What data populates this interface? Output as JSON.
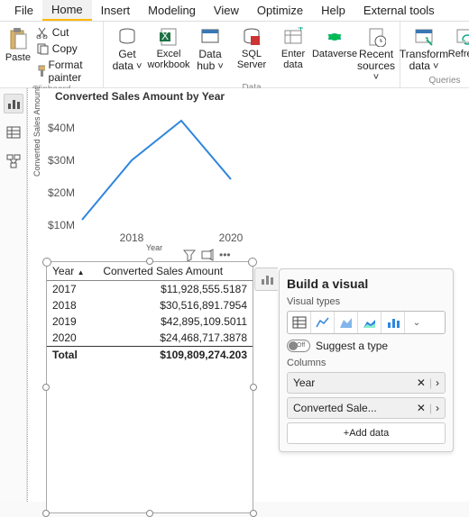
{
  "menubar": [
    "File",
    "Home",
    "Insert",
    "Modeling",
    "View",
    "Optimize",
    "Help",
    "External tools"
  ],
  "menubar_active": 1,
  "ribbon": {
    "clipboard": {
      "label": "Clipboard",
      "paste": "Paste",
      "cut": "Cut",
      "copy": "Copy",
      "format": "Format painter"
    },
    "data": {
      "label": "Data",
      "get": "Get data",
      "excel": "Excel workbook",
      "hub": "Data hub",
      "sql": "SQL Server",
      "enter": "Enter data",
      "dataverse": "Dataverse",
      "recent": "Recent sources"
    },
    "queries": {
      "label": "Queries",
      "transform": "Transform data",
      "refresh": "Refresh"
    }
  },
  "chart_data": {
    "type": "line",
    "title": "Converted Sales Amount by Year",
    "xlabel": "Year",
    "ylabel": "Converted Sales Amount",
    "x_ticks": [
      "2018",
      "2020"
    ],
    "y_ticks": [
      "$10M",
      "$20M",
      "$30M",
      "$40M"
    ],
    "x": [
      2017,
      2018,
      2019,
      2020
    ],
    "y": [
      11928555.5187,
      30516891.7954,
      42895109.5011,
      24468717.3878
    ],
    "ylim": [
      10000000,
      45000000
    ]
  },
  "table": {
    "headers": [
      "Year",
      "Converted Sales Amount"
    ],
    "rows": [
      [
        "2017",
        "$11,928,555.5187"
      ],
      [
        "2018",
        "$30,516,891.7954"
      ],
      [
        "2019",
        "$42,895,109.5011"
      ],
      [
        "2020",
        "$24,468,717.3878"
      ]
    ],
    "total_label": "Total",
    "total_value": "$109,809,274.203"
  },
  "panel": {
    "title": "Build a visual",
    "types_label": "Visual types",
    "suggest": "Suggest a type",
    "toggle_text": "Off",
    "columns_label": "Columns",
    "fields": [
      "Year",
      "Converted Sale..."
    ],
    "add": "+Add data"
  }
}
